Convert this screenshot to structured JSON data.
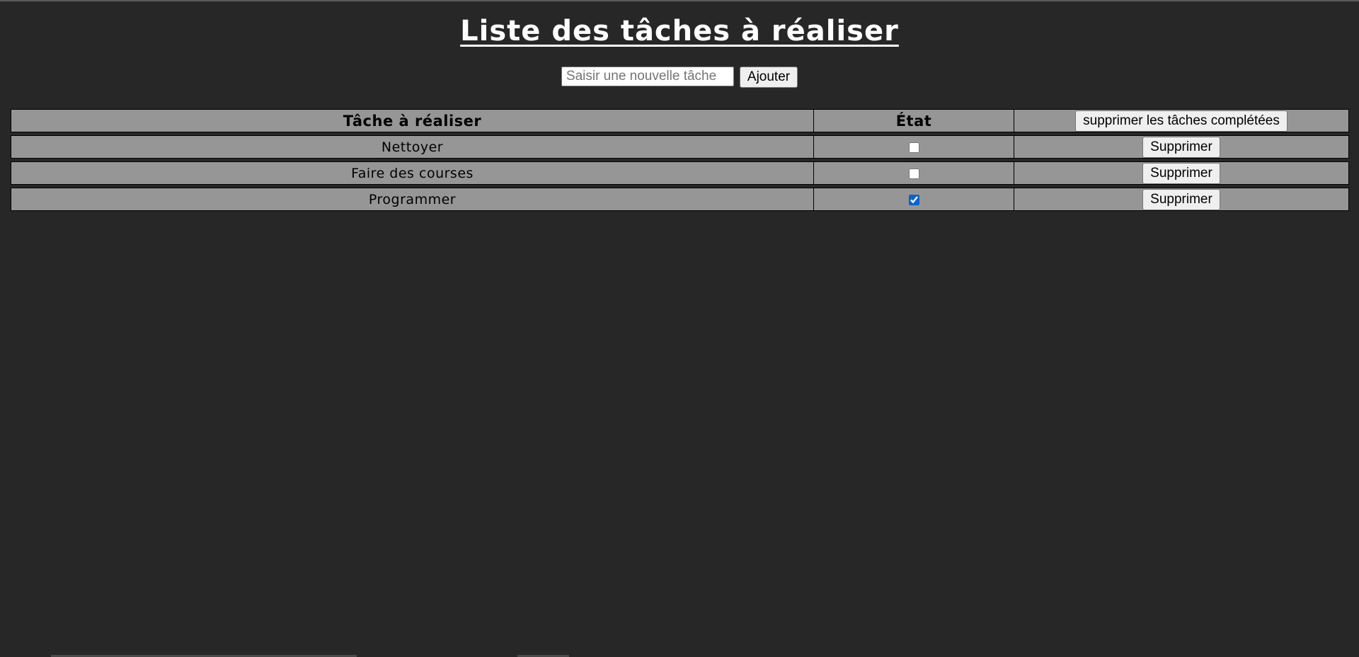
{
  "page": {
    "title": "Liste des tâches à réaliser"
  },
  "add_form": {
    "placeholder": "Saisir une nouvelle tâche",
    "value": "",
    "add_label": "Ajouter"
  },
  "table": {
    "headers": {
      "task": "Tâche à réaliser",
      "state": "État",
      "clear_completed_label": "supprimer les tâches complétées"
    },
    "rows": [
      {
        "task": "Nettoyer",
        "done": false,
        "delete_label": "Supprimer"
      },
      {
        "task": "Faire des courses",
        "done": false,
        "delete_label": "Supprimer"
      },
      {
        "task": "Programmer",
        "done": true,
        "delete_label": "Supprimer"
      }
    ]
  },
  "colors": {
    "background": "#272727",
    "row_background": "#969696",
    "title": "#ffffff",
    "checkbox_accent": "#0b63ce"
  }
}
